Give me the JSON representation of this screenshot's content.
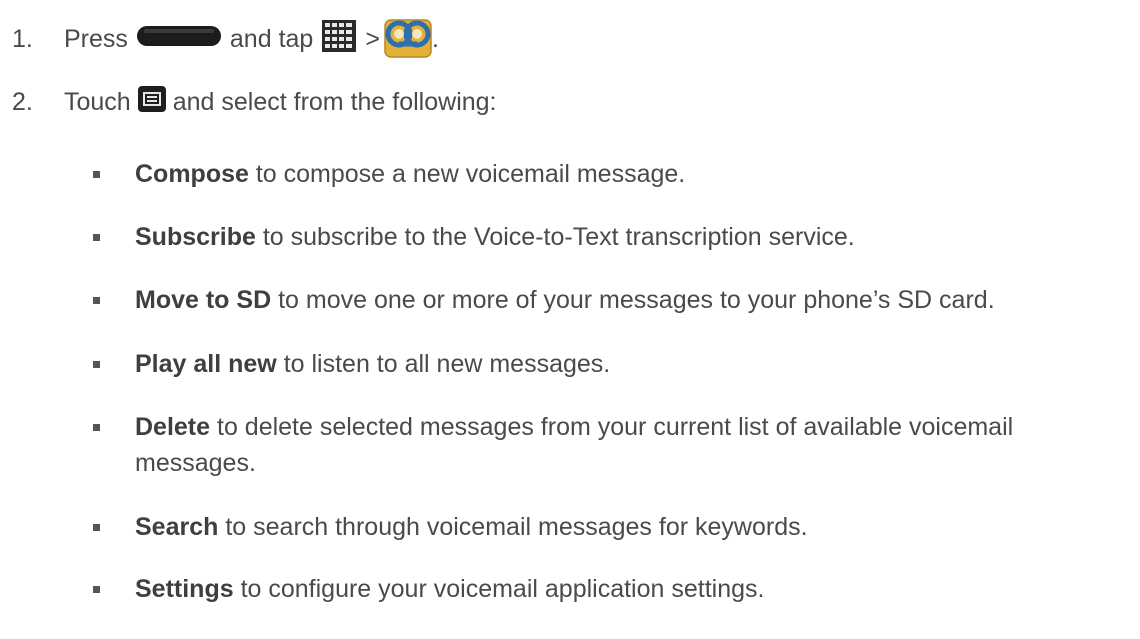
{
  "steps": [
    {
      "number": "1.",
      "text_before": "Press",
      "text_mid1": "and tap",
      "text_mid2": ">",
      "text_end": ".",
      "icons": [
        "home-key-icon",
        "apps-grid-icon",
        "voicemail-app-icon"
      ]
    },
    {
      "number": "2.",
      "text_before": "Touch",
      "text_after": "and select from the following:",
      "icons": [
        "menu-key-icon"
      ]
    }
  ],
  "options": [
    {
      "term": "Compose",
      "desc": " to compose a new voicemail message."
    },
    {
      "term": "Subscribe",
      "desc": " to subscribe to the Voice-to-Text transcription service."
    },
    {
      "term": "Move to SD",
      "desc": " to move one or more of your messages to your phone’s SD card."
    },
    {
      "term": "Play all new",
      "desc": " to listen to all new messages."
    },
    {
      "term": "Delete",
      "desc": " to delete selected messages from your current list of available voicemail",
      "desc_line2": "messages."
    },
    {
      "term": "Search",
      "desc": " to search through voicemail messages for keywords."
    },
    {
      "term": "Settings",
      "desc": " to configure your voicemail application settings."
    }
  ],
  "colors": {
    "text": "#4a4a4a",
    "voicemail_icon_bg": "#e3b13a",
    "voicemail_icon_ring": "#2e6fb0"
  }
}
